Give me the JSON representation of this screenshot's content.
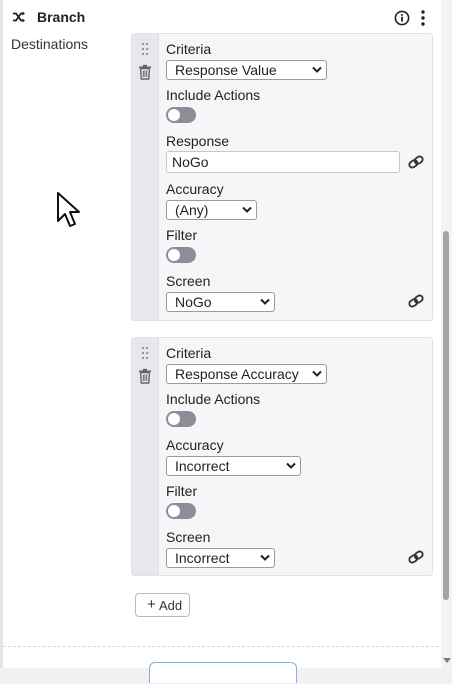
{
  "header": {
    "title": "Branch",
    "icons": {
      "leading": "shuffle-icon",
      "info": "info-icon",
      "menu": "kebab-icon"
    }
  },
  "destinations_label": "Destinations",
  "branches": [
    {
      "criteria_label": "Criteria",
      "criteria_value": "Response Value",
      "include_actions_label": "Include Actions",
      "include_actions_on": false,
      "response_label": "Response",
      "response_value": "NoGo",
      "accuracy_label": "Accuracy",
      "accuracy_value": "(Any)",
      "filter_label": "Filter",
      "filter_on": false,
      "screen_label": "Screen",
      "screen_value": "NoGo"
    },
    {
      "criteria_label": "Criteria",
      "criteria_value": "Response Accuracy",
      "include_actions_label": "Include Actions",
      "include_actions_on": false,
      "accuracy_label": "Accuracy",
      "accuracy_value": "Incorrect",
      "filter_label": "Filter",
      "filter_on": false,
      "screen_label": "Screen",
      "screen_value": "Incorrect"
    }
  ],
  "add_button": {
    "icon": "plus-icon",
    "label": "Add"
  },
  "colors": {
    "card_bg": "#f6f6f9",
    "toggle_off": "#8d8d99",
    "accent_border": "#7fb3e6"
  }
}
